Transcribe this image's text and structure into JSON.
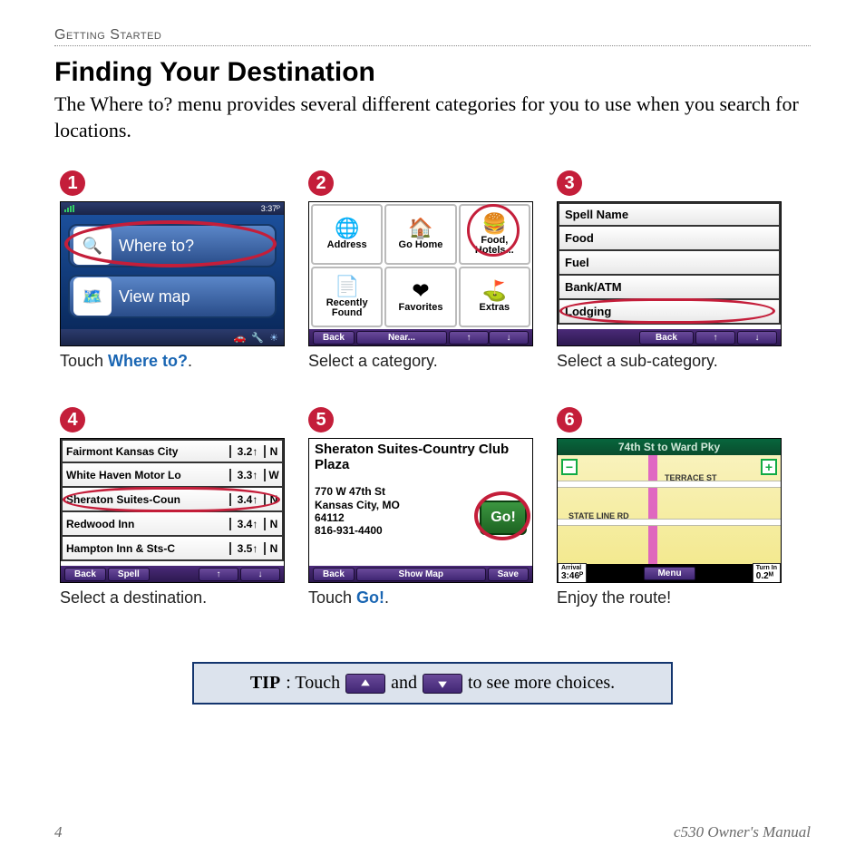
{
  "section_label": "Getting Started",
  "title": "Finding Your Destination",
  "intro": "The Where to? menu provides several different categories for you to use when you search for locations.",
  "steps": [
    {
      "num": "➊",
      "n": "1",
      "caption_pre": "Touch ",
      "caption_em": "Where to?",
      "caption_post": ".",
      "s1_time": "3:37ᴾ",
      "s1_btn1": "Where to?",
      "s1_btn2": "View map"
    },
    {
      "num": "➋",
      "n": "2",
      "caption_plain": "Select a category.",
      "cells": [
        {
          "icon": "🌐",
          "label": "Address"
        },
        {
          "icon": "🏠",
          "label": "Go Home"
        },
        {
          "icon": "🍔",
          "label": "Food, Hotels..."
        },
        {
          "icon": "📄",
          "label": "Recently Found"
        },
        {
          "icon": "❤",
          "label": "Favorites"
        },
        {
          "icon": "⛳",
          "label": "Extras"
        }
      ],
      "foot_back": "Back",
      "foot_near": "Near..."
    },
    {
      "num": "➌",
      "n": "3",
      "caption_plain": "Select a sub-category.",
      "rows": [
        "Spell Name",
        "Food",
        "Fuel",
        "Bank/ATM",
        "Lodging"
      ],
      "foot_back": "Back"
    },
    {
      "num": "➍",
      "n": "4",
      "caption_plain": "Select a destination.",
      "rows": [
        {
          "name": "Fairmont Kansas City",
          "dist": "3.2↑",
          "dir": "N"
        },
        {
          "name": "White Haven Motor Lo",
          "dist": "3.3↑",
          "dir": "W"
        },
        {
          "name": "Sheraton Suites-Coun",
          "dist": "3.4↑",
          "dir": "N"
        },
        {
          "name": "Redwood Inn",
          "dist": "3.4↑",
          "dir": "N"
        },
        {
          "name": "Hampton Inn & Sts-C",
          "dist": "3.5↑",
          "dir": "N"
        }
      ],
      "foot_back": "Back",
      "foot_spell": "Spell"
    },
    {
      "num": "➎",
      "n": "5",
      "caption_pre": "Touch ",
      "caption_em": "Go!",
      "caption_post": ".",
      "title": "Sheraton Suites-Country Club Plaza",
      "addr": "770 W 47th St\nKansas City, MO\n64112\n816-931-4400",
      "go": "Go!",
      "foot_back": "Back",
      "foot_map": "Show Map",
      "foot_save": "Save"
    },
    {
      "num": "➏",
      "n": "6",
      "caption_plain": "Enjoy the route!",
      "top": "74th St to Ward Pky",
      "label1": "TERRACE ST",
      "label2": "STATE LINE RD",
      "arrival_lbl": "Arrival",
      "arrival": "3:46ᴾ",
      "turn_lbl": "Turn In",
      "turn": "0.2ᴹ",
      "menu": "Menu"
    }
  ],
  "tip": {
    "lead": "TIP",
    "t1": ": Touch ",
    "t2": " and ",
    "t3": " to see more choices."
  },
  "footer": {
    "page": "4",
    "doc": "c530 Owner's Manual"
  }
}
